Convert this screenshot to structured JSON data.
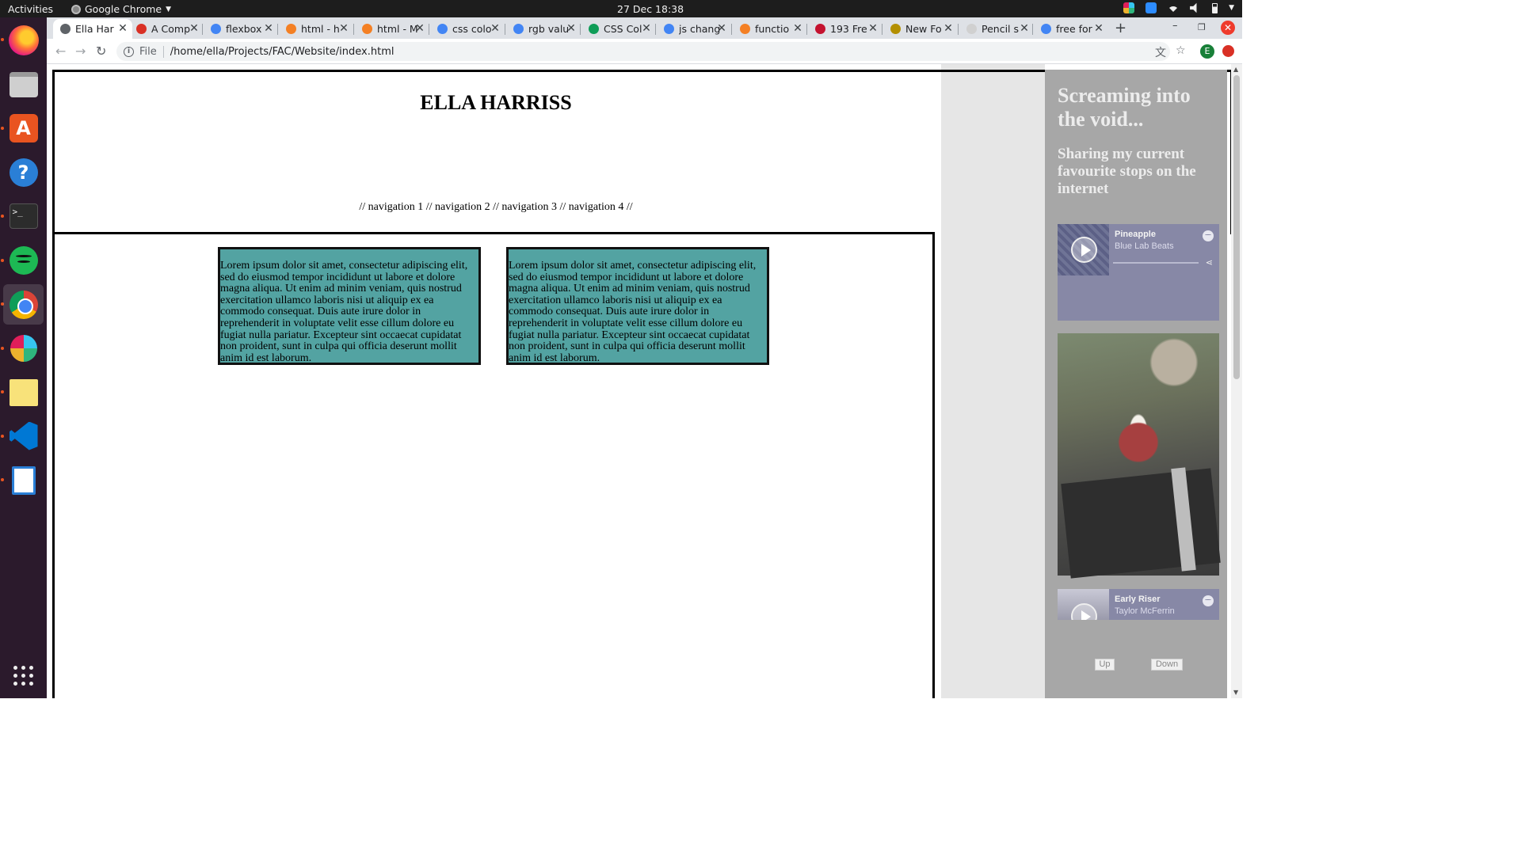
{
  "topbar": {
    "activities": "Activities",
    "app_name": "Google Chrome",
    "clock": "27 Dec  18:38"
  },
  "dock": {
    "items": [
      "firefox",
      "files",
      "software",
      "help",
      "terminal",
      "spotify",
      "chrome",
      "slack",
      "notes",
      "vscode",
      "writer",
      "show-apps"
    ]
  },
  "browser": {
    "tabs": [
      {
        "title": "Ella Har",
        "favicon_color": "#5f6368",
        "active": true
      },
      {
        "title": "A Comp",
        "favicon_color": "#d93025",
        "active": false
      },
      {
        "title": "flexbox",
        "favicon_color": "#4285f4",
        "active": false
      },
      {
        "title": "html - h",
        "favicon_color": "#f48024",
        "active": false
      },
      {
        "title": "html - M",
        "favicon_color": "#f48024",
        "active": false
      },
      {
        "title": "css colo",
        "favicon_color": "#4285f4",
        "active": false
      },
      {
        "title": "rgb valu",
        "favicon_color": "#4285f4",
        "active": false
      },
      {
        "title": "CSS Col",
        "favicon_color": "#0f9d58",
        "active": false
      },
      {
        "title": "js chang",
        "favicon_color": "#4285f4",
        "active": false
      },
      {
        "title": "functio",
        "favicon_color": "#f48024",
        "active": false
      },
      {
        "title": "193 Fre",
        "favicon_color": "#c4122f",
        "active": false
      },
      {
        "title": "New Fo",
        "favicon_color": "#b38f00",
        "active": false
      },
      {
        "title": "Pencil s",
        "favicon_color": "#d0d0d0",
        "active": false
      },
      {
        "title": "free for",
        "favicon_color": "#4285f4",
        "active": false
      }
    ],
    "file_label": "File",
    "url": "/home/ella/Projects/FAC/Website/index.html",
    "profile_initial": "E"
  },
  "page": {
    "title": "ELLA HARRISS",
    "nav": "// navigation 1 // navigation 2 // navigation 3 // navigation 4 //",
    "cards": [
      {
        "text": "Lorem ipsum dolor sit amet, consectetur adipiscing elit, sed do eiusmod tempor incididunt ut labore et dolore magna aliqua. Ut enim ad minim veniam, quis nostrud exercitation ullamco laboris nisi ut aliquip ex ea commodo consequat. Duis aute irure dolor in reprehenderit in voluptate velit esse cillum dolore eu fugiat nulla pariatur. Excepteur sint occaecat cupidatat non proident, sunt in culpa qui officia deserunt mollit anim id est laborum."
      },
      {
        "text": "Lorem ipsum dolor sit amet, consectetur adipiscing elit, sed do eiusmod tempor incididunt ut labore et dolore magna aliqua. Ut enim ad minim veniam, quis nostrud exercitation ullamco laboris nisi ut aliquip ex ea commodo consequat. Duis aute irure dolor in reprehenderit in voluptate velit esse cillum dolore eu fugiat nulla pariatur. Excepteur sint occaecat cupidatat non proident, sunt in culpa qui officia deserunt mollit anim id est laborum."
      }
    ],
    "card_color": "#53a3a2",
    "sidebar": {
      "title": "Screaming into the void...",
      "subtitle": "Sharing my current favourite stops on the internet",
      "players": [
        {
          "song": "Pineapple",
          "artist": "Blue Lab Beats"
        },
        {
          "song": "Early Riser",
          "artist": "Taylor McFerrin"
        }
      ],
      "up_label": "Up",
      "down_label": "Down",
      "bg_color": "#a7a7a7"
    }
  }
}
